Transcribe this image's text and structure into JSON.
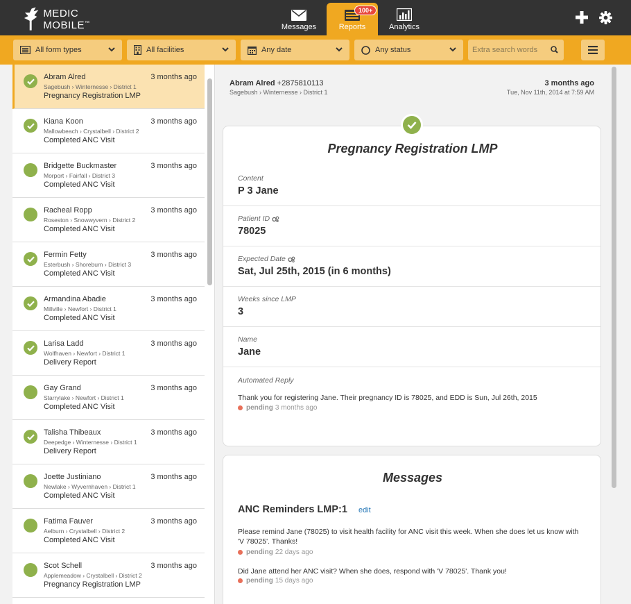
{
  "header": {
    "logo_text": "MEDIC MOBILE",
    "logo_tm": "™",
    "tabs": [
      {
        "label": "Messages",
        "icon": "envelope-icon"
      },
      {
        "label": "Reports",
        "icon": "reports-icon",
        "badge": "100+",
        "active": true
      },
      {
        "label": "Analytics",
        "icon": "bar-chart-icon"
      }
    ],
    "actions": [
      {
        "icon": "plus-icon"
      },
      {
        "icon": "gear-icon"
      }
    ]
  },
  "filters": {
    "form_types": "All form types",
    "facilities": "All facilities",
    "date": "Any date",
    "status": "Any status",
    "search_placeholder": "Extra search words"
  },
  "reports": [
    {
      "name": "Abram Alred",
      "place": "Sagebush › Winternesse › District 1",
      "form": "Pregnancy Registration LMP",
      "time": "3 months ago",
      "verified": true,
      "selected": true
    },
    {
      "name": "Kiana Koon",
      "place": "Mallowbeach › Crystalbell › District 2",
      "form": "Completed ANC Visit",
      "time": "3 months ago",
      "verified": true
    },
    {
      "name": "Bridgette Buckmaster",
      "place": "Morport › Fairfall › District 3",
      "form": "Completed ANC Visit",
      "time": "3 months ago",
      "verified": false
    },
    {
      "name": "Racheal Ropp",
      "place": "Roseston › Snowwyvern › District 2",
      "form": "Completed ANC Visit",
      "time": "3 months ago",
      "verified": false
    },
    {
      "name": "Fermin Fetty",
      "place": "Esterbush › Shoreburn › District 3",
      "form": "Completed ANC Visit",
      "time": "3 months ago",
      "verified": true
    },
    {
      "name": "Armandina Abadie",
      "place": "Millville › Newfort › District 1",
      "form": "Completed ANC Visit",
      "time": "3 months ago",
      "verified": true
    },
    {
      "name": "Larisa Ladd",
      "place": "Wolfhaven › Newfort › District 1",
      "form": "Delivery Report",
      "time": "3 months ago",
      "verified": true
    },
    {
      "name": "Gay Grand",
      "place": "Starrylake › Newfort › District 1",
      "form": "Completed ANC Visit",
      "time": "3 months ago",
      "verified": false
    },
    {
      "name": "Talisha Thibeaux",
      "place": "Deepedge › Winternesse › District 1",
      "form": "Delivery Report",
      "time": "3 months ago",
      "verified": true
    },
    {
      "name": "Joette Justiniano",
      "place": "Newlake › Wyvernhaven › District 1",
      "form": "Completed ANC Visit",
      "time": "3 months ago",
      "verified": false
    },
    {
      "name": "Fatima Fauver",
      "place": "Aelburn › Crystalbell › District 2",
      "form": "Completed ANC Visit",
      "time": "3 months ago",
      "verified": false
    },
    {
      "name": "Scot Schell",
      "place": "Applemeadow › Crystalbell › District 2",
      "form": "Pregnancy Registration LMP",
      "time": "3 months ago",
      "verified": false
    }
  ],
  "detail": {
    "sender_name": "Abram Alred",
    "sender_phone": "+2875810113",
    "sender_place": "Sagebush › Winternesse › District 1",
    "relative_time": "3 months ago",
    "absolute_time": "Tue, Nov 11th, 2014 at 7:59 AM",
    "title": "Pregnancy Registration LMP",
    "fields": [
      {
        "label": "Content",
        "value": "P 3 Jane",
        "computed": false
      },
      {
        "label": "Patient ID",
        "value": "78025",
        "computed": true
      },
      {
        "label": "Expected Date",
        "value": "Sat, Jul 25th, 2015 (in 6 months)",
        "computed": true
      },
      {
        "label": "Weeks since LMP",
        "value": "3",
        "computed": false
      },
      {
        "label": "Name",
        "value": "Jane",
        "computed": false
      }
    ],
    "reply_label": "Automated Reply",
    "reply_text": "Thank you for registering Jane. Their pregnancy ID is 78025, and EDD is Sun, Jul 26th, 2015",
    "reply_status": "pending",
    "reply_status_time": "3 months ago"
  },
  "messages": {
    "title": "Messages",
    "group": "ANC Reminders LMP:1",
    "edit_label": "edit",
    "items": [
      {
        "text": "Please remind Jane (78025) to visit health facility for ANC visit this week. When she does let us know with 'V 78025'. Thanks!",
        "status": "pending",
        "status_time": "22 days ago"
      },
      {
        "text": "Did Jane attend her ANC visit? When she does, respond with 'V 78025'. Thank you!",
        "status": "pending",
        "status_time": "15 days ago"
      }
    ]
  },
  "colors": {
    "brand": "#f0a821",
    "header_bg": "#333333",
    "verified": "#8fb14c",
    "pending_dot": "#e8705a",
    "link": "#2a7ab8"
  }
}
